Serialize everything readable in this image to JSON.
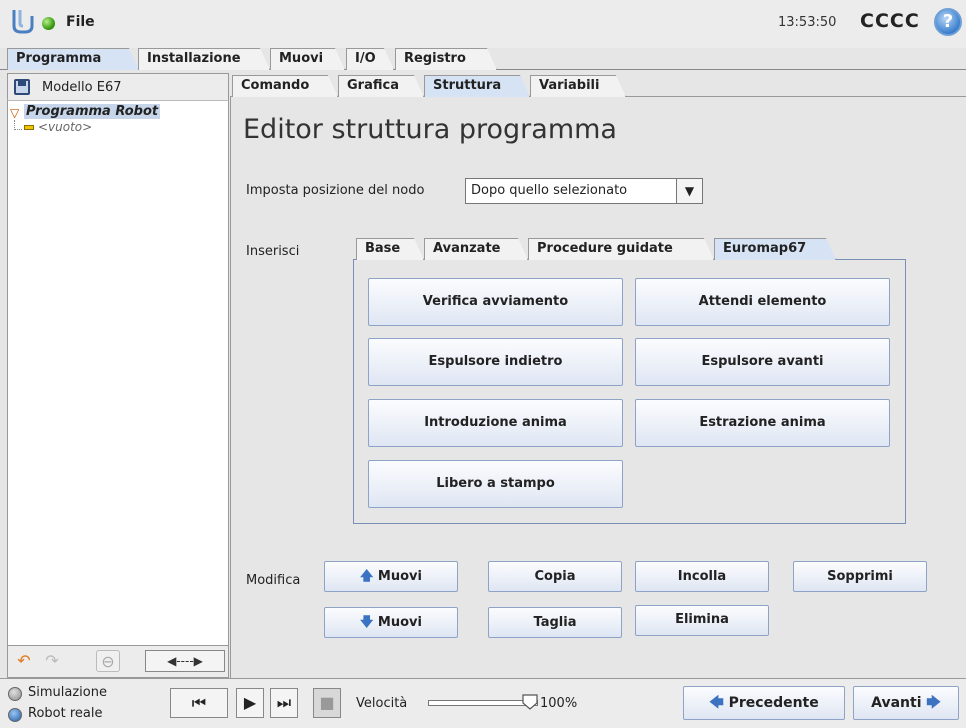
{
  "topbar": {
    "file_menu": "File",
    "time": "13:53:50",
    "robot_name": "CCCC",
    "help": "?"
  },
  "main_tabs": [
    "Programma",
    "Installazione",
    "Muovi",
    "I/O",
    "Registro"
  ],
  "left_panel": {
    "model_name": "Modello E67",
    "tree": {
      "root": "Programma Robot",
      "child": "<vuoto>"
    },
    "nav_scroll": "◀----▶"
  },
  "sub_tabs": [
    "Comando",
    "Grafica",
    "Struttura",
    "Variabili"
  ],
  "editor": {
    "title": "Editor struttura programma",
    "node_position_label": "Imposta posizione del nodo",
    "node_position_value": "Dopo quello selezionato",
    "insert_label": "Inserisci",
    "insert_tabs": [
      "Base",
      "Avanzate",
      "Procedure guidate",
      "Euromap67"
    ],
    "euromap_buttons": [
      "Verifica avviamento",
      "Attendi elemento",
      "Espulsore indietro",
      "Espulsore avanti",
      "Introduzione anima",
      "Estrazione anima",
      "Libero a stampo"
    ],
    "edit_label": "Modifica",
    "edit_buttons": {
      "move_up": "Muovi",
      "move_down": "Muovi",
      "copy": "Copia",
      "paste": "Incolla",
      "suppress": "Sopprimi",
      "cut": "Taglia",
      "delete": "Elimina"
    }
  },
  "bottombar": {
    "simulation": "Simulazione",
    "real_robot": "Robot reale",
    "speed_label": "Velocità",
    "speed_value": "100%",
    "speed_fraction": 1.0,
    "previous": "Precedente",
    "next": "Avanti"
  },
  "colors": {
    "active_tab": "#d5e3f5",
    "selected_node": "#c7d5ea",
    "button_border": "#8fa3c6",
    "accent_blue": "#3b73c2",
    "undo_orange": "#e07a1e"
  },
  "icons": {
    "status": "green-status-dot-icon",
    "help": "question-mark-icon",
    "save": "floppy-disk-icon",
    "undo": "undo-arrow-icon",
    "redo": "redo-arrow-icon",
    "move_up": "arrow-up-icon",
    "move_down": "arrow-down-icon",
    "previous": "arrow-left-icon",
    "next": "arrow-right-icon"
  }
}
